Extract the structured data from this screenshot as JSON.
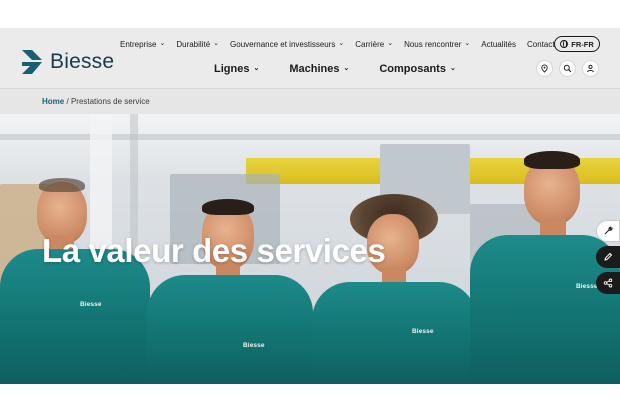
{
  "brand": {
    "name": "Biesse",
    "accent": "#1b5d73",
    "logo_color": "#183a4a"
  },
  "top_nav": {
    "items": [
      {
        "label": "Entreprise",
        "has_dropdown": true
      },
      {
        "label": "Durabilité",
        "has_dropdown": true
      },
      {
        "label": "Gouvernance et investisseurs",
        "has_dropdown": true
      },
      {
        "label": "Carrière",
        "has_dropdown": true
      },
      {
        "label": "Nous rencontrer",
        "has_dropdown": true
      },
      {
        "label": "Actualités",
        "has_dropdown": false
      },
      {
        "label": "Contact",
        "has_dropdown": false
      }
    ],
    "language": "FR-FR",
    "language_icon": "globe-icon"
  },
  "main_nav": {
    "items": [
      {
        "label": "Lignes"
      },
      {
        "label": "Machines"
      },
      {
        "label": "Composants"
      }
    ]
  },
  "header_icons": [
    "location-pin-icon",
    "search-icon",
    "user-icon"
  ],
  "breadcrumb": {
    "home": "Home",
    "separator": "/",
    "current": "Prestations de service"
  },
  "hero": {
    "title": "La valeur des services",
    "shirt_logo": "Biesse",
    "shirt_color": "#157b7a"
  },
  "side_tools": [
    "wrench-icon",
    "pencil-icon",
    "share-icon"
  ]
}
